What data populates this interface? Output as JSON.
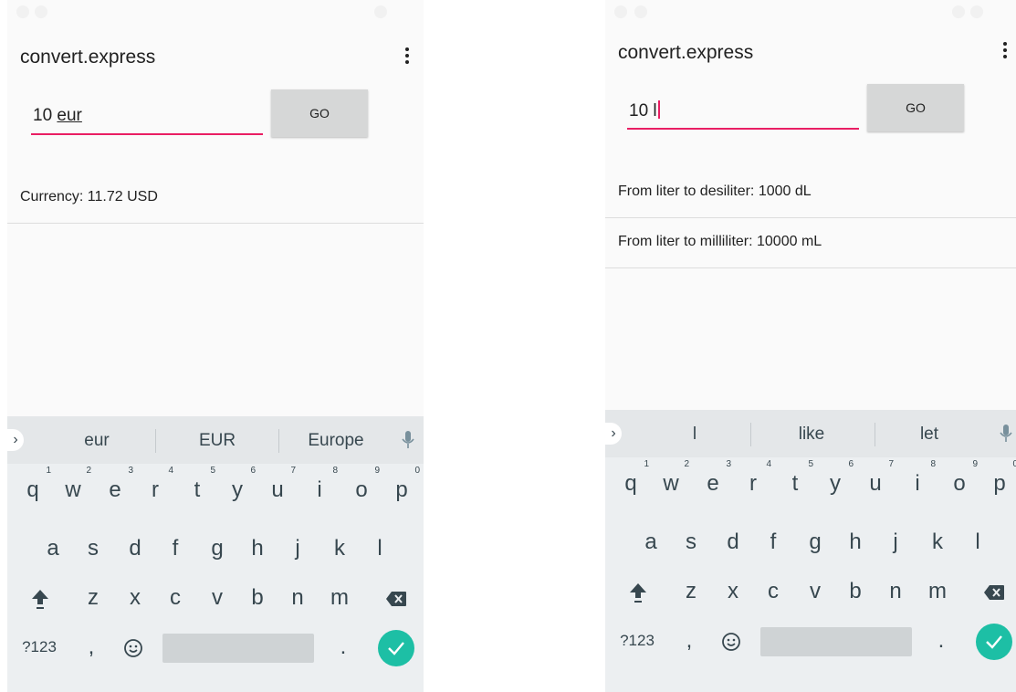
{
  "colors": {
    "accent": "#e91e63",
    "enter_key": "#1dbfa5",
    "go_button_bg": "#d6d7d7",
    "keyboard_bg": "#eceff1"
  },
  "screens": [
    {
      "app_title": "convert.express",
      "input": {
        "value": "10 ",
        "composing": "eur"
      },
      "go_label": "GO",
      "results": [
        "Currency: 11.72 USD"
      ],
      "suggestions": [
        "eur",
        "EUR",
        "Europe"
      ]
    },
    {
      "app_title": "convert.express",
      "input": {
        "value": "10 l",
        "composing": ""
      },
      "go_label": "GO",
      "results": [
        "From liter to desiliter: 1000 dL",
        "From liter to milliliter: 10000 mL"
      ],
      "suggestions": [
        "l",
        "like",
        "let"
      ]
    }
  ],
  "keyboard": {
    "row1": [
      "q",
      "w",
      "e",
      "r",
      "t",
      "y",
      "u",
      "i",
      "o",
      "p"
    ],
    "row1_digits": [
      "1",
      "2",
      "3",
      "4",
      "5",
      "6",
      "7",
      "8",
      "9",
      "0"
    ],
    "row2": [
      "a",
      "s",
      "d",
      "f",
      "g",
      "h",
      "j",
      "k",
      "l"
    ],
    "row3": [
      "z",
      "x",
      "c",
      "v",
      "b",
      "n",
      "m"
    ],
    "symbols_label": "?123",
    "comma": ",",
    "period": "."
  },
  "icons": {
    "overflow": "more-vert-icon",
    "mic": "mic-icon",
    "shift": "shift-icon",
    "backspace": "backspace-icon",
    "emoji": "emoji-icon",
    "enter": "check-icon",
    "chevron": "chevron-right-icon"
  }
}
